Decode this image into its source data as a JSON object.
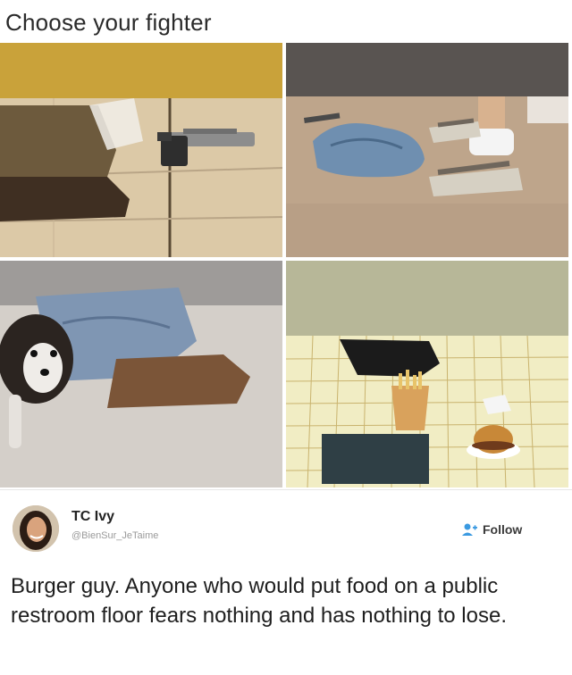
{
  "header": {
    "title": "Choose your fighter"
  },
  "images": [
    {
      "name": "stall-pistol",
      "icon": "pistol-icon"
    },
    {
      "name": "stall-sandals-bag",
      "icon": "sandals-icon"
    },
    {
      "name": "stall-dog-in-pants",
      "icon": "dog-icon"
    },
    {
      "name": "stall-burger-fries",
      "icon": "burger-icon"
    }
  ],
  "tweet": {
    "author_name": "TC Ivy",
    "author_handle": "@BienSur_JeTaime",
    "follow_label": "Follow",
    "text": "Burger guy. Anyone who would put food on a public restroom floor fears nothing and has nothing to lose."
  },
  "colors": {
    "follow_icon": "#3b9ae1"
  }
}
